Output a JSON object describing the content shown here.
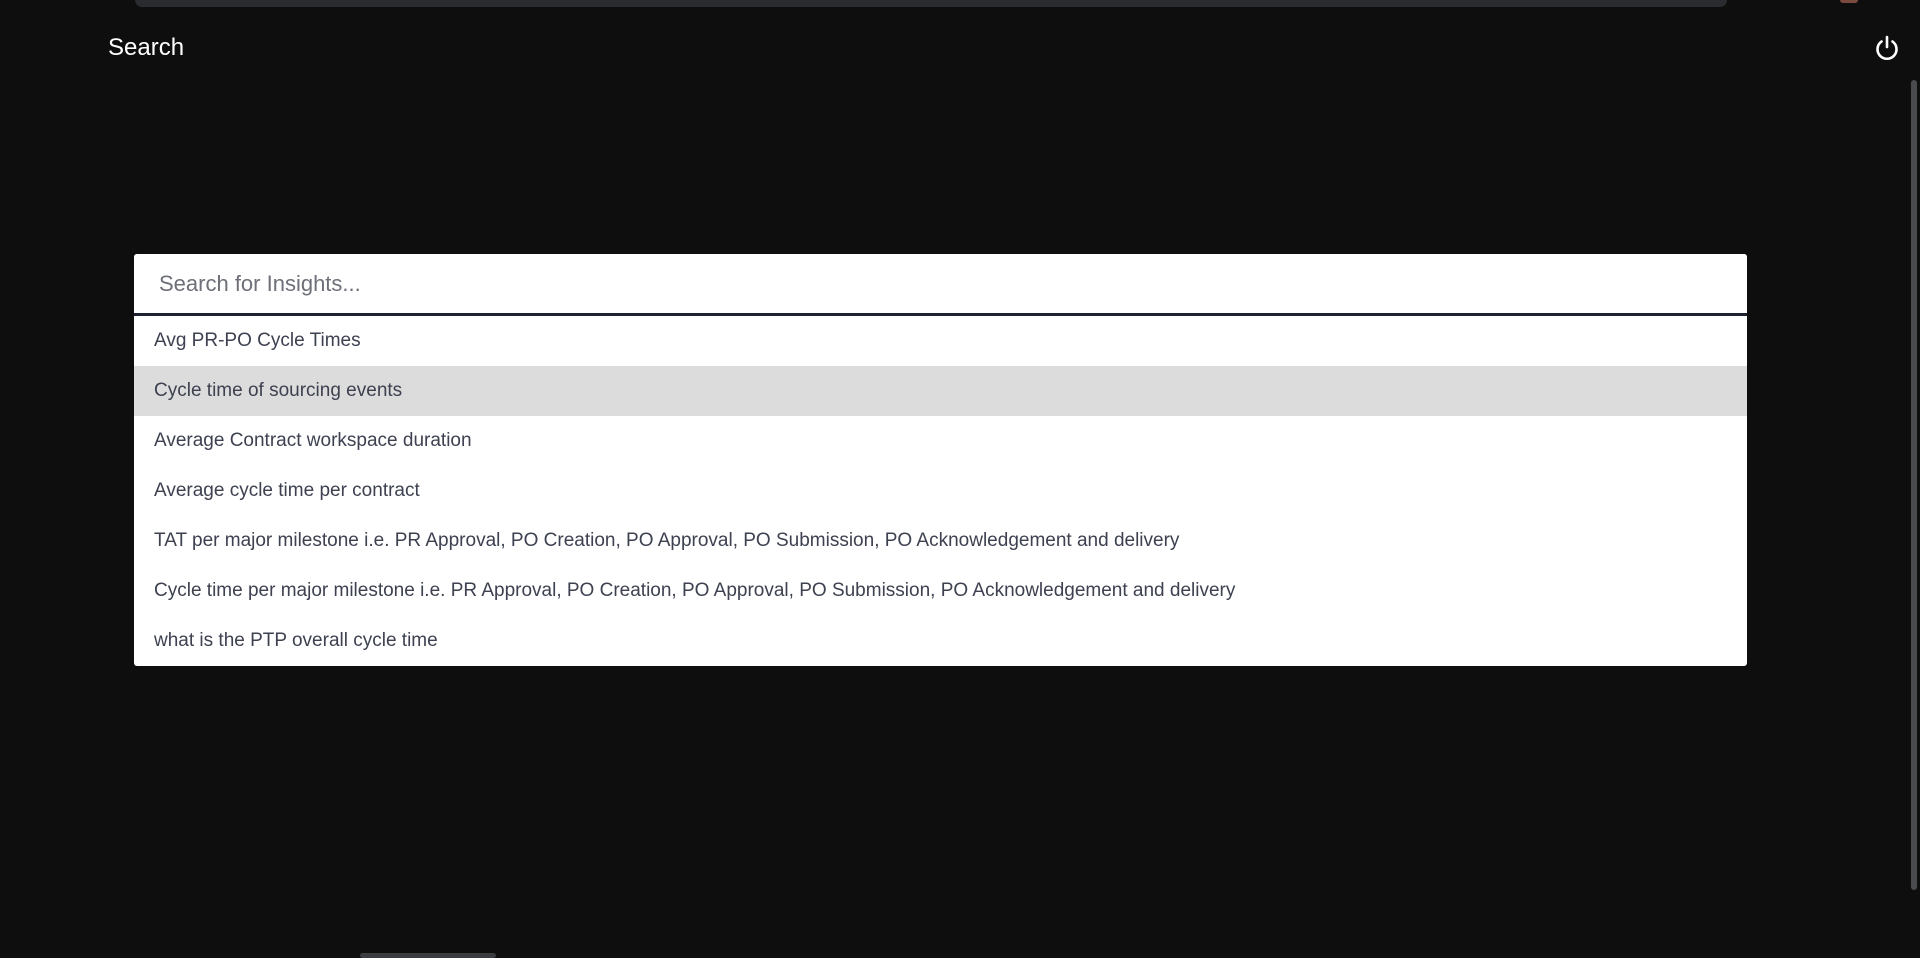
{
  "header": {
    "title": "Search",
    "power_icon": "power-icon"
  },
  "search": {
    "placeholder": "Search for Insights...",
    "value": ""
  },
  "suggestions": [
    "Avg PR-PO Cycle Times",
    "Cycle time of sourcing events",
    "Average Contract workspace duration",
    "Average cycle time per contract",
    "TAT per major milestone i.e. PR Approval, PO Creation, PO Approval, PO Submission, PO Acknowledgement and delivery",
    "Cycle time per major milestone i.e. PR Approval, PO Creation, PO Approval, PO Submission, PO Acknowledgement and delivery",
    "what is the PTP overall cycle time"
  ],
  "highlighted_index": 1,
  "colors": {
    "background": "#0e0e0f",
    "highlight": "#dcdcdc",
    "text": "#3d4150"
  }
}
